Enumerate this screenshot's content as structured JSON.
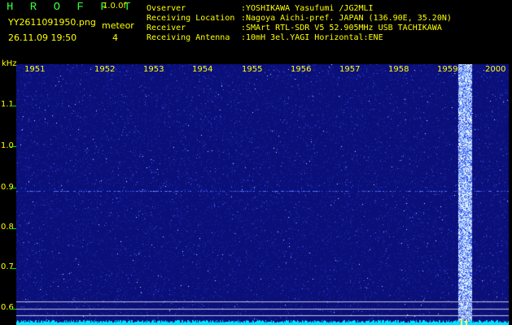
{
  "header": {
    "app_title": "H R O F F T",
    "version": "1.0.0f",
    "filename": "YY2611091950.png",
    "datetime": "26.11.09 19:50",
    "count_label": "meteor",
    "count_value": "4"
  },
  "info": [
    {
      "key": "Ovserver",
      "value": ":YOSHIKAWA Yasufumi /JG2MLI"
    },
    {
      "key": "Receiving Location",
      "value": ":Nagoya Aichi-pref. JAPAN (136.90E, 35.20N)"
    },
    {
      "key": "Receiver",
      "value": ":SMArt RTL-SDR V5 52.905MHz USB TACHIKAWA"
    },
    {
      "key": "Receiving Antenna",
      "value": ":10mH 3el.YAGI Horizontal:ENE"
    }
  ],
  "spectrogram": {
    "y_unit": "kHz",
    "y_labels": [
      "1.1",
      "1.0",
      "0.9",
      "0.8",
      "0.7",
      "0.6"
    ],
    "time_labels": [
      "1951",
      "1952",
      "1953",
      "1954",
      "1955",
      "1956",
      "1957",
      "1958",
      "1959",
      "2000"
    ],
    "colors": {
      "background": "#0a0f7a",
      "noise": "#3a5cff",
      "signal": "#e8f6ff",
      "label": "#ffff00",
      "tick": "#00e000",
      "bottom": "#00e5ff"
    }
  }
}
